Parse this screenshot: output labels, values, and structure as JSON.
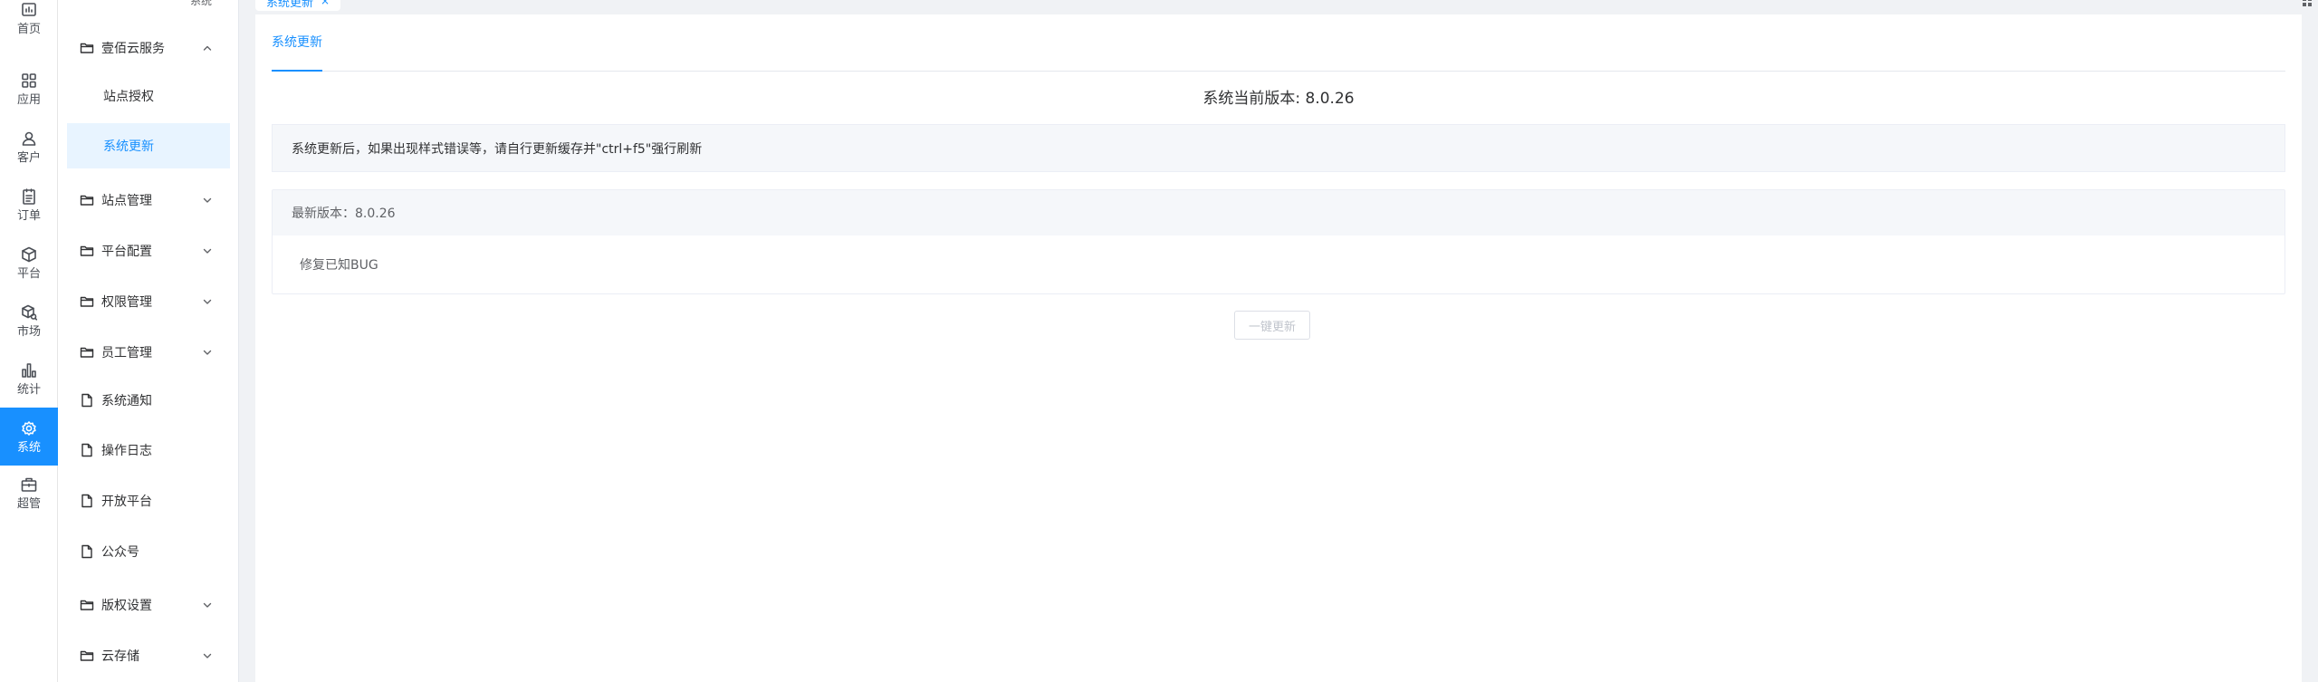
{
  "rail": {
    "items": [
      {
        "label": "首页",
        "icon": "chart-icon"
      },
      {
        "label": "应用",
        "icon": "apps-icon"
      },
      {
        "label": "客户",
        "icon": "user-icon"
      },
      {
        "label": "订单",
        "icon": "order-icon"
      },
      {
        "label": "平台",
        "icon": "box-icon"
      },
      {
        "label": "市场",
        "icon": "market-icon"
      },
      {
        "label": "统计",
        "icon": "bar-chart-icon"
      },
      {
        "label": "系统",
        "icon": "gear-icon"
      },
      {
        "label": "超管",
        "icon": "briefcase-icon"
      }
    ],
    "active_index": 7,
    "active_color": "#1890ff"
  },
  "submenu": {
    "top_stub": "系统",
    "items": [
      {
        "label": "壹佰云服务",
        "type": "folder",
        "arrow": "up"
      },
      {
        "label": "站点授权",
        "type": "child"
      },
      {
        "label": "系统更新",
        "type": "child",
        "active": true
      },
      {
        "label": "站点管理",
        "type": "folder",
        "arrow": "down"
      },
      {
        "label": "平台配置",
        "type": "folder",
        "arrow": "down"
      },
      {
        "label": "权限管理",
        "type": "folder",
        "arrow": "down"
      },
      {
        "label": "员工管理",
        "type": "folder",
        "arrow": "down"
      },
      {
        "label": "系统通知",
        "type": "doc"
      },
      {
        "label": "操作日志",
        "type": "doc"
      },
      {
        "label": "开放平台",
        "type": "doc"
      },
      {
        "label": "公众号",
        "type": "doc"
      },
      {
        "label": "版权设置",
        "type": "folder",
        "arrow": "down"
      },
      {
        "label": "云存储",
        "type": "folder",
        "arrow": "down"
      }
    ]
  },
  "tabs": {
    "active_label": "系统更新",
    "close_glyph": "×"
  },
  "content": {
    "tab_label": "系统更新",
    "current_version": "系统当前版本: 8.0.26",
    "notice": "系统更新后，如果出现样式错误等，请自行更新缓存并\"ctrl+f5\"强行刷新",
    "latest_version": "最新版本：8.0.26",
    "changelog": "修复已知BUG",
    "update_button": "一键更新"
  }
}
